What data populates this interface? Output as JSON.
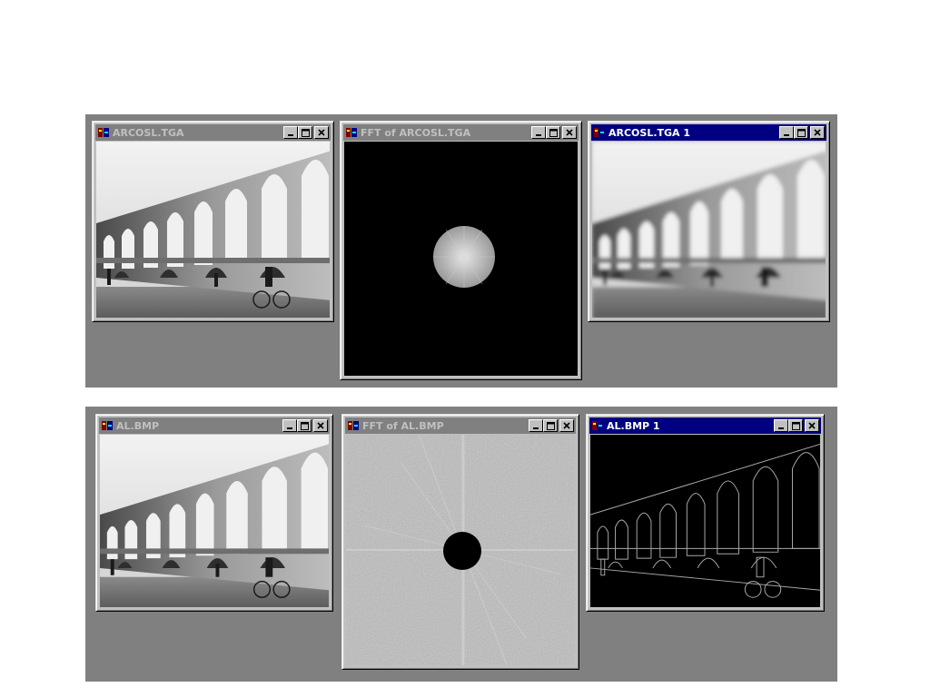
{
  "colors": {
    "desktop": "#808080",
    "window_face": "#c0c0c0",
    "active_title": "#000080",
    "inactive_title": "#808080"
  },
  "icons": {
    "app": "image-app-icon",
    "minimize": "minimize-icon",
    "maximize": "maximize-icon",
    "close": "close-icon"
  },
  "top_row": {
    "original": {
      "title": "ARCOSL.TGA",
      "active": false
    },
    "fft": {
      "title": "FFT of ARCOSL.TGA",
      "active": false
    },
    "result": {
      "title": "ARCOSL.TGA 1",
      "active": true
    }
  },
  "bottom_row": {
    "original": {
      "title": "AL.BMP",
      "active": false
    },
    "fft": {
      "title": "FFT of AL.BMP",
      "active": false
    },
    "result": {
      "title": "AL.BMP 1",
      "active": true
    }
  }
}
